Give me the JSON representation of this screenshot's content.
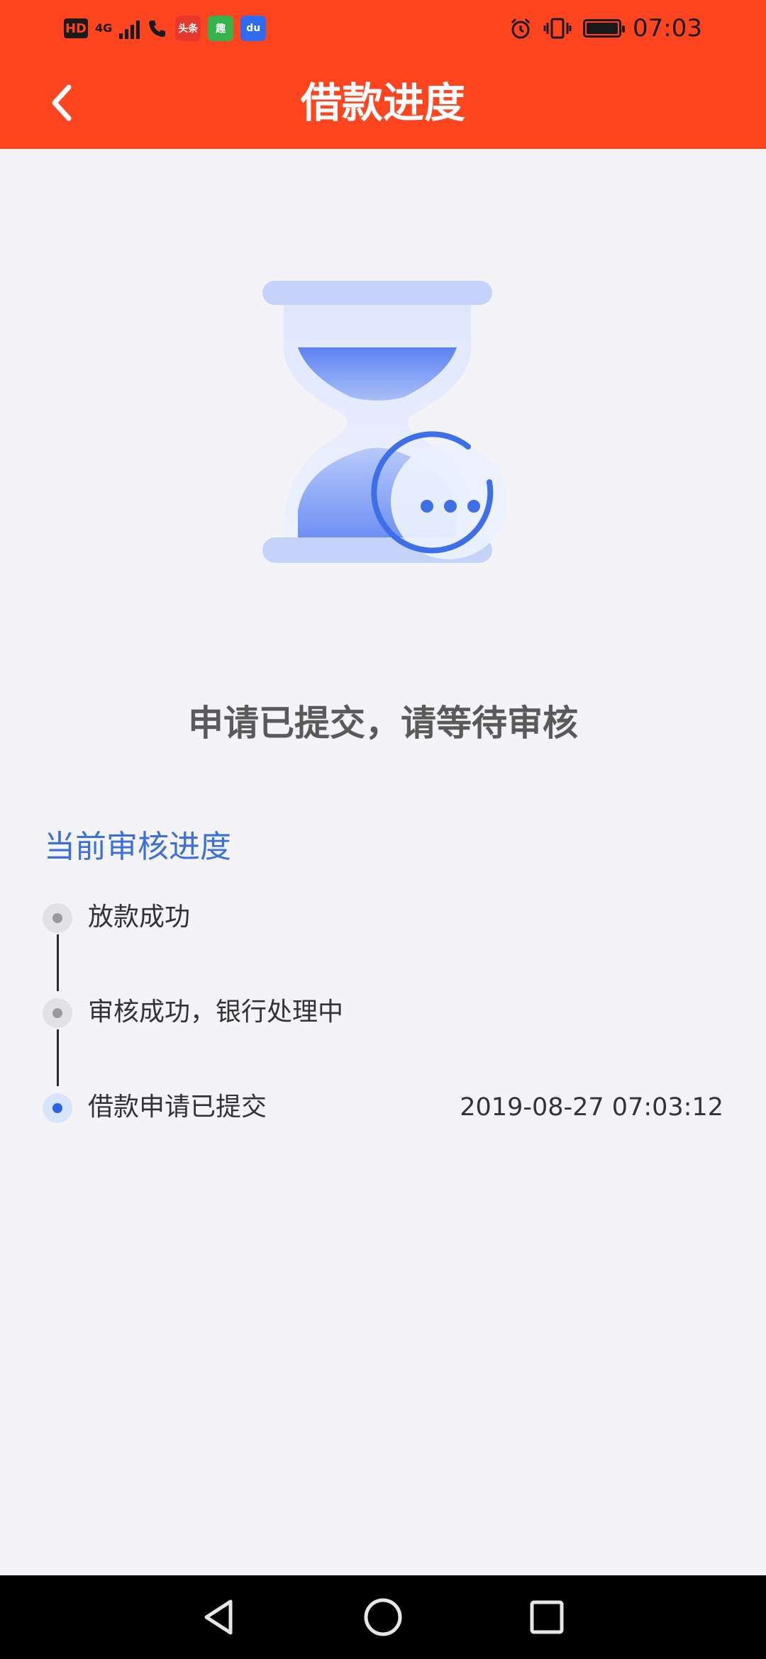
{
  "status_bar": {
    "hd_label": "HD",
    "network": "4G",
    "apps": [
      {
        "name": "toutiao-app-icon",
        "label": "头条",
        "bg": "#e8372c",
        "fg": "#ffffff"
      },
      {
        "name": "qutoutiao-app-icon",
        "label": "趣",
        "bg": "#36b24a",
        "fg": "#ffffff"
      },
      {
        "name": "baidu-app-icon",
        "label": "du",
        "bg": "#2f6bea",
        "fg": "#ffffff"
      }
    ],
    "time": "07:03"
  },
  "header": {
    "title": "借款进度",
    "bg_color": "#ff4420"
  },
  "result": {
    "message": "申请已提交，请等待审核"
  },
  "progress": {
    "title": "当前审核进度",
    "accent_color": "#3d6fdb",
    "steps": [
      {
        "label": "放款成功",
        "time": "",
        "active": false
      },
      {
        "label": "审核成功，银行处理中",
        "time": "",
        "active": false
      },
      {
        "label": "借款申请已提交",
        "time": "2019-08-27 07:03:12",
        "active": true
      }
    ]
  },
  "nav_bar": {
    "icons": [
      "back-triangle-icon",
      "home-circle-icon",
      "recents-square-icon"
    ]
  }
}
